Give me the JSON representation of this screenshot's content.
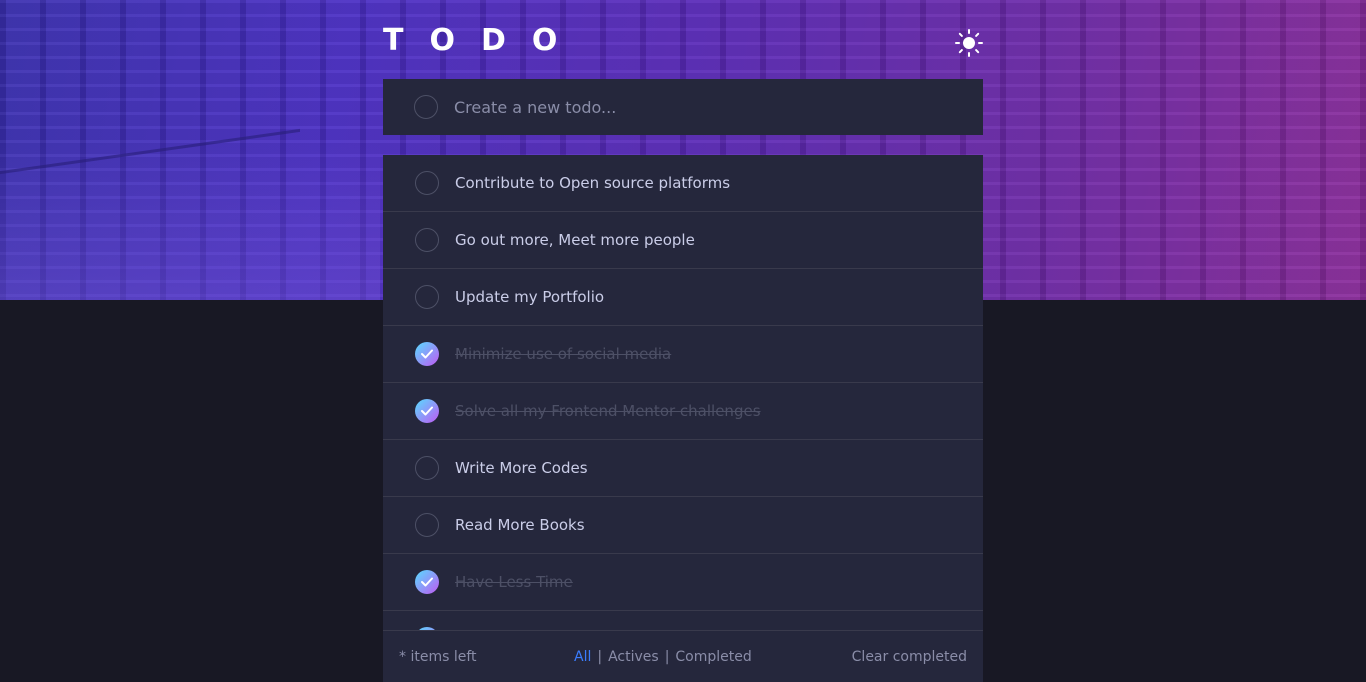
{
  "header": {
    "title": "TODO",
    "theme_icon": "sun-icon"
  },
  "new_todo": {
    "placeholder": "Create a new todo..."
  },
  "todos": [
    {
      "text": "Contribute to Open source platforms",
      "completed": false
    },
    {
      "text": "Go out more, Meet more people",
      "completed": false
    },
    {
      "text": "Update my Portfolio",
      "completed": false
    },
    {
      "text": "Minimize use of social media",
      "completed": true
    },
    {
      "text": "Solve all my Frontend Mentor challenges",
      "completed": true
    },
    {
      "text": "Write More Codes",
      "completed": false
    },
    {
      "text": "Read More Books",
      "completed": false
    },
    {
      "text": "Have Less Time",
      "completed": true
    }
  ],
  "footer": {
    "items_left": "* items left",
    "filter_all": "All",
    "filter_active": "Actives",
    "filter_completed": "Completed",
    "separator": "|",
    "clear_completed": "Clear completed"
  },
  "colors": {
    "background": "#181824",
    "card": "#25273c",
    "text": "#cacde8",
    "completed_text": "#4d5066",
    "active_filter": "#3a7cfd",
    "check_gradient_start": "#57ddff",
    "check_gradient_end": "#c058f3"
  }
}
